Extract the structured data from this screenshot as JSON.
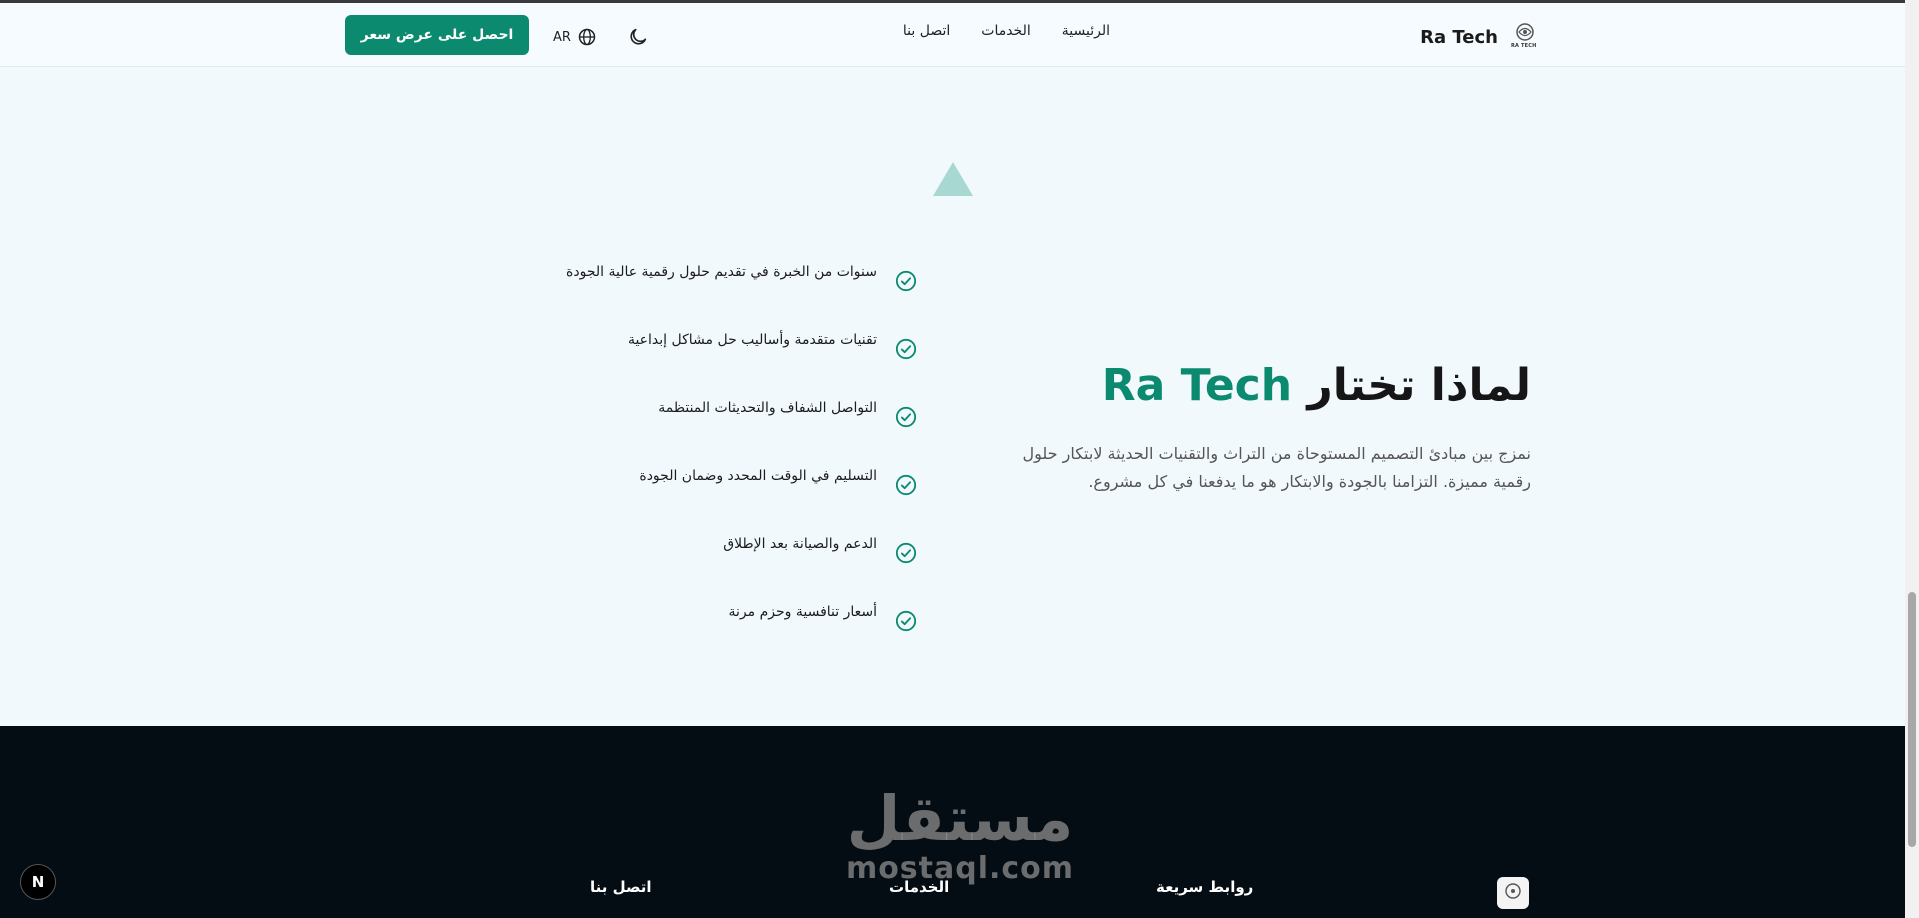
{
  "header": {
    "brand": "Ra Tech",
    "logo_mini_text": "RA TECH",
    "nav": [
      "الرئيسية",
      "الخدمات",
      "اتصل بنا"
    ],
    "language": "AR",
    "cta_label": "احصل على عرض سعر"
  },
  "why": {
    "heading_prefix": "لماذا تختار",
    "heading_accent": "Ra Tech",
    "description": "نمزج بين مبادئ التصميم المستوحاة من التراث والتقنيات الحديثة لابتكار حلول رقمية مميزة. التزامنا بالجودة والابتكار هو ما يدفعنا في كل مشروع.",
    "features": [
      "سنوات من الخبرة في تقديم حلول رقمية عالية الجودة",
      "تقنيات متقدمة وأساليب حل مشاكل إبداعية",
      "التواصل الشفاف والتحديثات المنتظمة",
      "التسليم في الوقت المحدد وضمان الجودة",
      "الدعم والصيانة بعد الإطلاق",
      "أسعار تنافسية وحزم مرنة"
    ]
  },
  "footer": {
    "quick_links": "روابط سريعة",
    "services": "الخدمات",
    "contact": "اتصل بنا",
    "watermark_ar": "مستقل",
    "watermark_en": "mostaql.com"
  },
  "dev_badge": "N",
  "colors": {
    "accent": "#0b8a70",
    "footer_bg": "#050d14",
    "page_bg": "#f2f9fd"
  },
  "icons": [
    "moon-icon",
    "globe-icon",
    "check-circle-icon",
    "triangle-shape"
  ]
}
